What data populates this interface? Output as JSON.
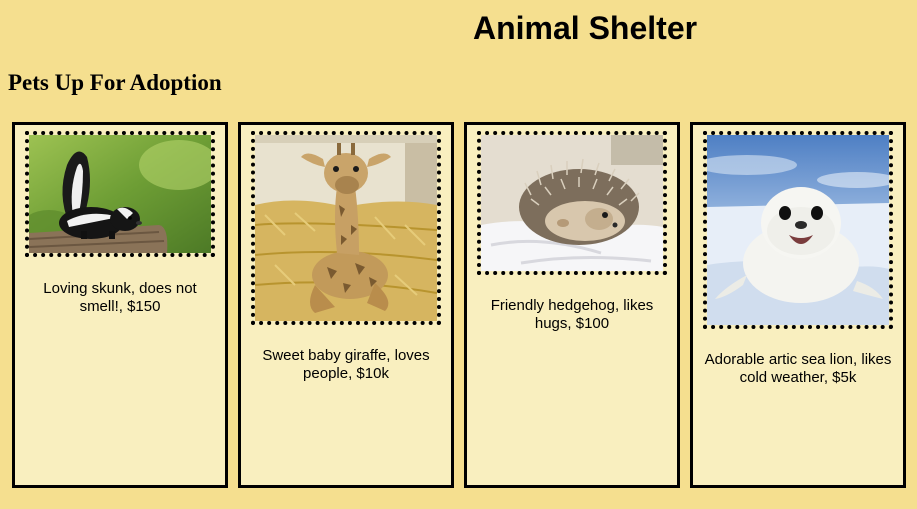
{
  "header": {
    "title": "Animal Shelter",
    "subtitle": "Pets Up For Adoption"
  },
  "pets": [
    {
      "animal": "skunk",
      "caption": "Loving skunk, does not smell!, $150"
    },
    {
      "animal": "giraffe",
      "caption": "Sweet baby giraffe, loves people, $10k"
    },
    {
      "animal": "hedgehog",
      "caption": "Friendly hedgehog, likes hugs, $100"
    },
    {
      "animal": "seal",
      "caption": "Adorable artic sea lion, likes cold weather, $5k"
    }
  ],
  "colors": {
    "page_background": "#f5df8f",
    "card_background": "#f9efbf",
    "border": "#000000"
  }
}
